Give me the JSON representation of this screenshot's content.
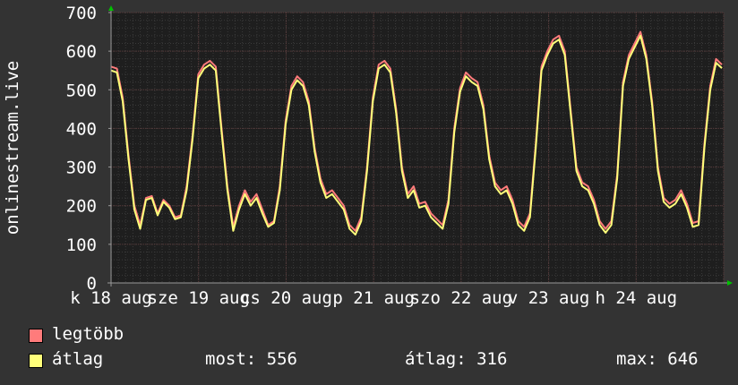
{
  "chart_data": {
    "type": "line",
    "ylabel": "onlinestream.live",
    "ylim": [
      0,
      700
    ],
    "yticks": [
      0,
      100,
      200,
      300,
      400,
      500,
      600,
      700
    ],
    "xtick_labels": [
      "k 18 aug",
      "sze 19 aug",
      "cs 20 aug",
      "p 21 aug",
      "szo 22 aug",
      "v 23 aug",
      "h 24 aug"
    ],
    "grid": true,
    "colors": {
      "background": "#333333",
      "plot": "#1e1e1e",
      "grid": "#5a3a3a",
      "max": "#ff7b7b",
      "avg": "#ffff7a",
      "axis_arrow": "#00c000"
    },
    "series": [
      {
        "name": "legtöbb",
        "color": "#ff7b7b",
        "values": [
          560,
          555,
          480,
          330,
          200,
          150,
          220,
          225,
          180,
          215,
          200,
          170,
          175,
          250,
          380,
          540,
          565,
          575,
          560,
          400,
          250,
          145,
          200,
          240,
          210,
          230,
          190,
          150,
          160,
          250,
          420,
          510,
          535,
          520,
          470,
          350,
          270,
          230,
          240,
          220,
          200,
          150,
          135,
          170,
          300,
          480,
          565,
          575,
          555,
          450,
          300,
          230,
          250,
          205,
          210,
          180,
          165,
          150,
          215,
          400,
          505,
          545,
          530,
          520,
          460,
          330,
          260,
          240,
          250,
          215,
          160,
          145,
          180,
          360,
          560,
          600,
          630,
          640,
          600,
          450,
          300,
          260,
          250,
          215,
          160,
          140,
          160,
          280,
          520,
          590,
          620,
          650,
          590,
          470,
          300,
          220,
          205,
          215,
          240,
          205,
          155,
          160,
          360,
          510,
          580,
          565
        ]
      },
      {
        "name": "átlag",
        "color": "#ffff7a",
        "values": [
          550,
          545,
          470,
          320,
          190,
          140,
          215,
          220,
          175,
          210,
          195,
          165,
          170,
          240,
          370,
          530,
          555,
          565,
          550,
          390,
          240,
          135,
          190,
          230,
          200,
          220,
          180,
          145,
          155,
          240,
          410,
          500,
          525,
          510,
          460,
          340,
          260,
          220,
          230,
          210,
          190,
          140,
          125,
          160,
          290,
          470,
          555,
          565,
          545,
          440,
          290,
          220,
          240,
          195,
          200,
          170,
          155,
          140,
          205,
          390,
          495,
          535,
          520,
          510,
          450,
          320,
          250,
          230,
          240,
          205,
          150,
          135,
          170,
          350,
          550,
          590,
          620,
          630,
          590,
          440,
          290,
          250,
          240,
          205,
          150,
          130,
          150,
          270,
          510,
          580,
          610,
          640,
          580,
          460,
          290,
          210,
          195,
          205,
          230,
          195,
          145,
          150,
          350,
          500,
          570,
          556
        ]
      }
    ],
    "legend": [
      {
        "label": "legtöbb",
        "color": "#ff7b7b"
      },
      {
        "label": "átlag",
        "color": "#ffff7a"
      }
    ],
    "stats": {
      "most": "most: 556",
      "atlag": "átlag: 316",
      "max": "max: 646"
    }
  }
}
